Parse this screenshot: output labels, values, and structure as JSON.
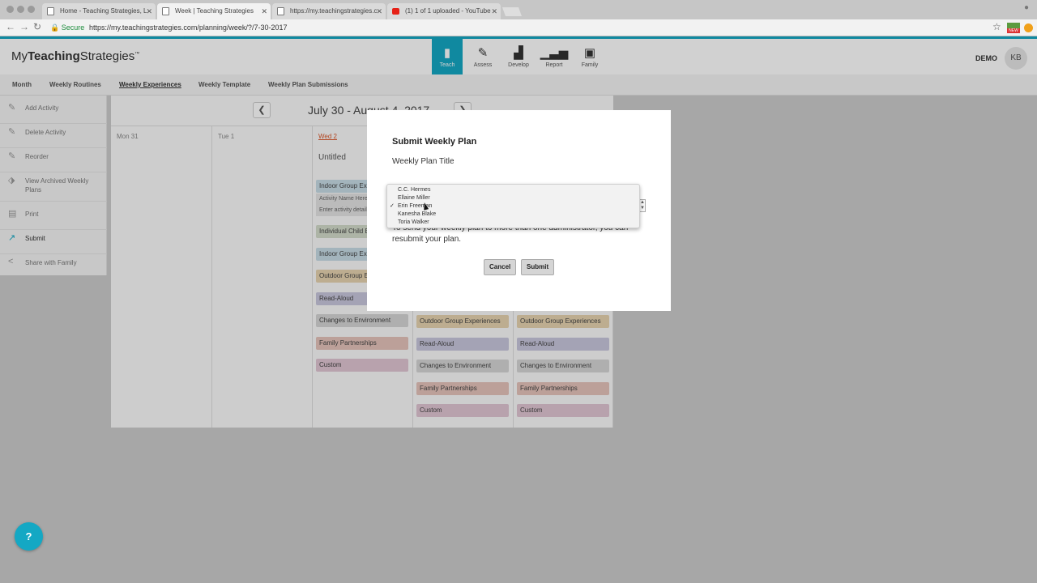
{
  "browser": {
    "tabs": [
      {
        "title": "Home - Teaching Strategies, L"
      },
      {
        "title": "Week | Teaching Strategies"
      },
      {
        "title": "https://my.teachingstrategies.c"
      },
      {
        "title": "(1) 1 of 1 uploaded - YouTube"
      }
    ],
    "secure_label": "Secure",
    "url": "https://my.teachingstrategies.com/planning/week/?/7-30-2017",
    "extension_badge": "NEW"
  },
  "app": {
    "logo_prefix": "My",
    "logo_bold": "Teaching",
    "logo_suffix": "Strategies",
    "logo_tm": "™",
    "nav": [
      {
        "label": "Teach",
        "icon": "book-icon"
      },
      {
        "label": "Assess",
        "icon": "pencil-icon"
      },
      {
        "label": "Develop",
        "icon": "blocks-icon"
      },
      {
        "label": "Report",
        "icon": "bar-chart-icon"
      },
      {
        "label": "Family",
        "icon": "photo-icon"
      }
    ],
    "user_label": "DEMO",
    "user_initials": "KB"
  },
  "subnav": [
    "Month",
    "Weekly Routines",
    "Weekly Experiences",
    "Weekly Template",
    "Weekly Plan Submissions"
  ],
  "sidebar": [
    {
      "label": "Add Activity"
    },
    {
      "label": "Delete Activity"
    },
    {
      "label": "Reorder"
    },
    {
      "label": "View Archived Weekly Plans"
    },
    {
      "label": "Print"
    },
    {
      "label": "Submit"
    },
    {
      "label": "Share with Family"
    }
  ],
  "calendar": {
    "title": "July 30 - August 4, 2017",
    "days": [
      "Mon 31",
      "Tue 1",
      "Wed 2"
    ],
    "wed": {
      "untitled": "Untitled",
      "activity_name_placeholder": "Activity Name Here",
      "activity_details_placeholder": "Enter activity details",
      "items": [
        "Indoor Group Experiences",
        "Individual Child Experiences",
        "Indoor Group Experiences",
        "Outdoor Group Experiences",
        "Read-Aloud",
        "Changes to Environment",
        "Family Partnerships",
        "Custom"
      ]
    },
    "thu_items": [
      "Outdoor Group Experiences",
      "Read-Aloud",
      "Changes to Environment",
      "Family Partnerships",
      "Custom"
    ],
    "fri_items": [
      "Outdoor Group Experiences",
      "Read-Aloud",
      "Changes to Environment",
      "Family Partnerships",
      "Custom"
    ]
  },
  "modal": {
    "title": "Submit Weekly Plan",
    "field_label": "Weekly Plan Title",
    "note": "To send your weekly plan to more than one administrator, you can resubmit your plan.",
    "cancel": "Cancel",
    "submit": "Submit",
    "options": [
      "C.C. Hermes",
      "Ellaine Miller",
      "Erin Freeman",
      "Kanesha Blake",
      "Toria Walker"
    ],
    "selected": "Erin Freeman"
  },
  "help_label": "?",
  "colors": {
    "accent": "#14a8c4",
    "today": "#d9572b"
  }
}
